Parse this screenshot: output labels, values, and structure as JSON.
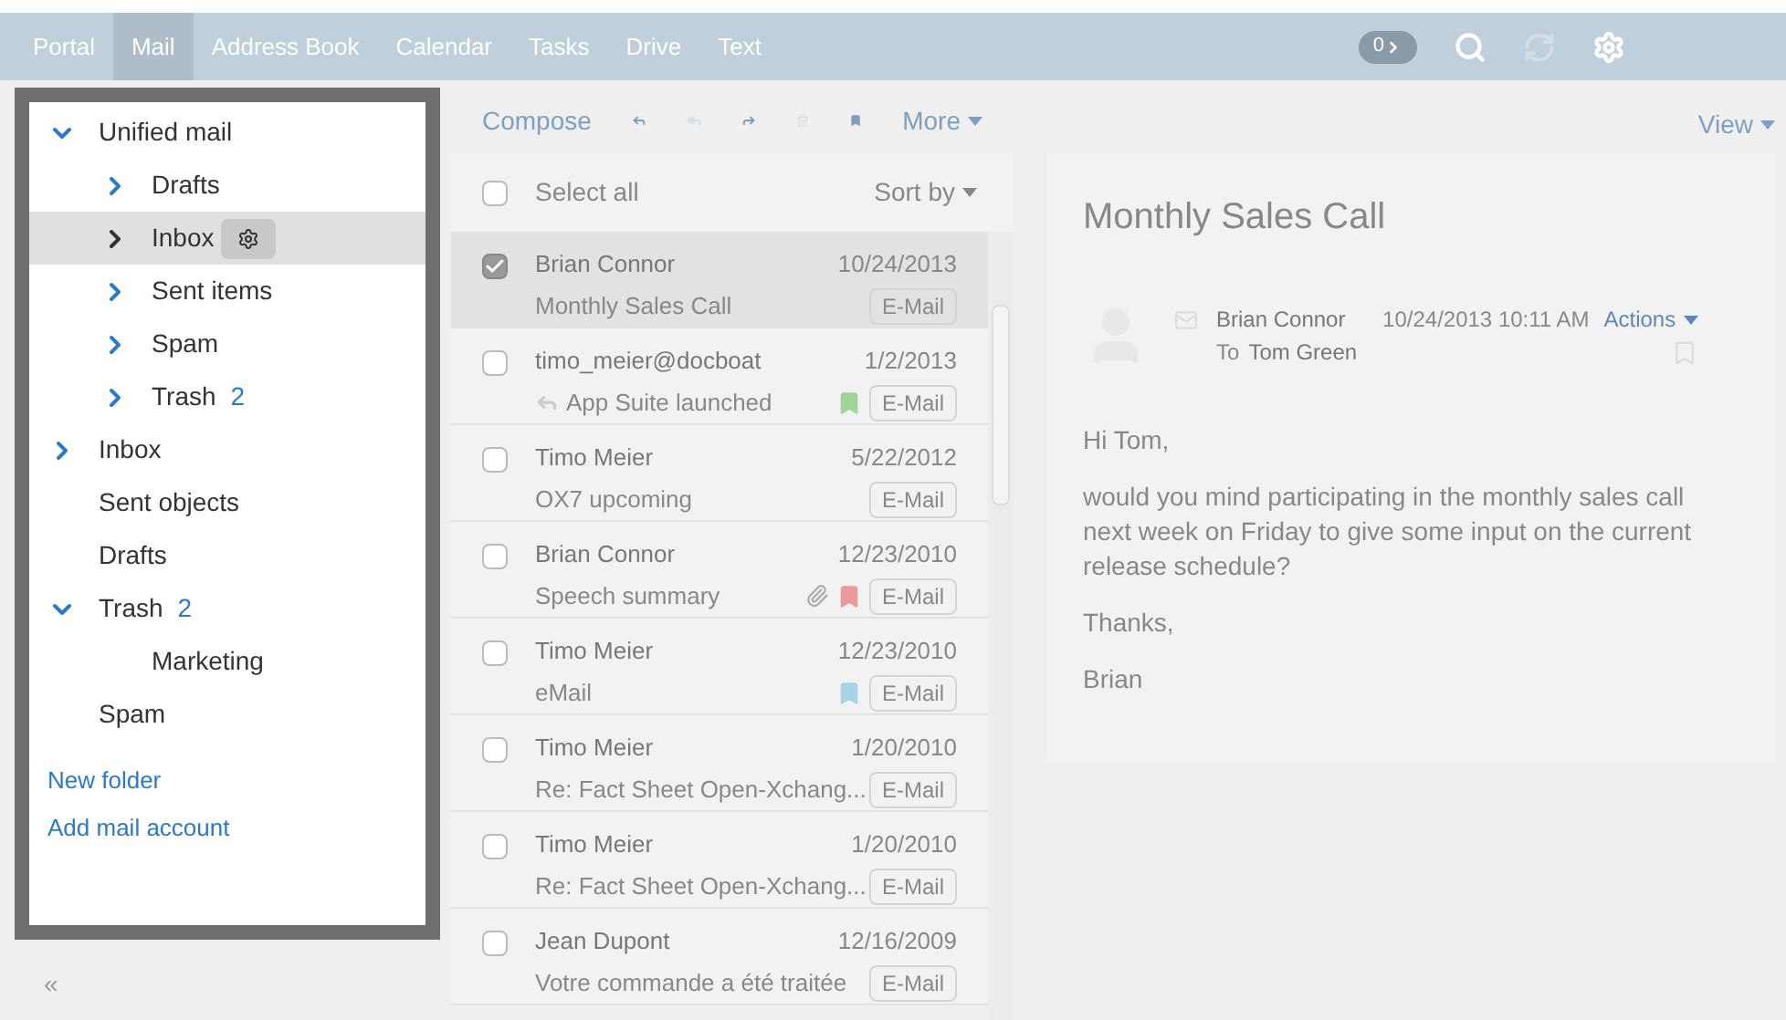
{
  "top_nav": {
    "items": [
      {
        "label": "Portal",
        "selected": false
      },
      {
        "label": "Mail",
        "selected": true
      },
      {
        "label": "Address Book",
        "selected": false
      },
      {
        "label": "Calendar",
        "selected": false
      },
      {
        "label": "Tasks",
        "selected": false
      },
      {
        "label": "Drive",
        "selected": false
      },
      {
        "label": "Text",
        "selected": false
      }
    ],
    "notification_count": "0"
  },
  "folders": [
    {
      "label": "Unified mail",
      "kind": "expandable",
      "expanded": true,
      "selected": false,
      "children": [
        {
          "label": "Drafts",
          "kind": "expandable",
          "expanded": false,
          "selected": false
        },
        {
          "label": "Inbox",
          "kind": "expandable",
          "expanded": false,
          "selected": true
        },
        {
          "label": "Sent items",
          "kind": "expandable",
          "expanded": false,
          "selected": false
        },
        {
          "label": "Spam",
          "kind": "expandable",
          "expanded": false,
          "selected": false
        },
        {
          "label": "Trash",
          "kind": "expandable",
          "expanded": false,
          "selected": false,
          "count": "2"
        }
      ]
    },
    {
      "label": "Inbox",
      "kind": "expandable",
      "expanded": false,
      "selected": false
    },
    {
      "label": "Sent objects",
      "kind": "plain",
      "selected": false
    },
    {
      "label": "Drafts",
      "kind": "plain",
      "selected": false
    },
    {
      "label": "Trash",
      "kind": "expandable",
      "expanded": true,
      "selected": false,
      "count": "2",
      "children": [
        {
          "label": "Marketing",
          "kind": "plain",
          "selected": false
        }
      ]
    },
    {
      "label": "Spam",
      "kind": "plain",
      "selected": false
    }
  ],
  "folder_links": [
    "New folder",
    "Add mail account"
  ],
  "collapse_label": "«",
  "toolbar": {
    "compose": "Compose",
    "more": "More",
    "view": "View"
  },
  "list_header": {
    "select_all": "Select all",
    "sort_by": "Sort by",
    "checked": false
  },
  "mails": [
    {
      "sender": "Brian Connor",
      "date": "10/24/2013",
      "subject": "Monthly Sales Call",
      "tag": "E-Mail",
      "selected": true,
      "checked": true,
      "replied": false,
      "attachment": false
    },
    {
      "sender": "timo_meier@docboat",
      "date": "1/2/2013",
      "subject": "App Suite launched",
      "tag": "E-Mail",
      "selected": false,
      "checked": false,
      "replied": true,
      "attachment": false,
      "color": "#9fd39a"
    },
    {
      "sender": "Timo Meier",
      "date": "5/22/2012",
      "subject": "OX7 upcoming",
      "tag": "E-Mail",
      "selected": false,
      "checked": false,
      "replied": false,
      "attachment": false
    },
    {
      "sender": "Brian Connor",
      "date": "12/23/2010",
      "subject": "Speech summary",
      "tag": "E-Mail",
      "selected": false,
      "checked": false,
      "replied": false,
      "attachment": true,
      "color": "#e99a9a"
    },
    {
      "sender": "Timo Meier",
      "date": "12/23/2010",
      "subject": "eMail",
      "tag": "E-Mail",
      "selected": false,
      "checked": false,
      "replied": false,
      "attachment": false,
      "color": "#a9d3e6"
    },
    {
      "sender": "Timo Meier",
      "date": "1/20/2010",
      "subject": "Re: Fact Sheet Open-Xchang...",
      "tag": "E-Mail",
      "selected": false,
      "checked": false,
      "replied": false,
      "attachment": false
    },
    {
      "sender": "Timo Meier",
      "date": "1/20/2010",
      "subject": "Re: Fact Sheet Open-Xchang...",
      "tag": "E-Mail",
      "selected": false,
      "checked": false,
      "replied": false,
      "attachment": false
    },
    {
      "sender": "Jean Dupont",
      "date": "12/16/2009",
      "subject": "Votre commande a été traitée",
      "tag": "E-Mail",
      "selected": false,
      "checked": false,
      "replied": false,
      "attachment": false
    }
  ],
  "detail": {
    "subject": "Monthly Sales Call",
    "from": "Brian Connor",
    "datetime": "10/24/2013 10:11 AM",
    "actions": "Actions",
    "to_label": "To",
    "to": "Tom Green",
    "body": [
      "Hi Tom,",
      "would you mind participating in the monthly sales call next week on Friday to give some input on the current release schedule?",
      "Thanks,",
      "Brian"
    ]
  }
}
